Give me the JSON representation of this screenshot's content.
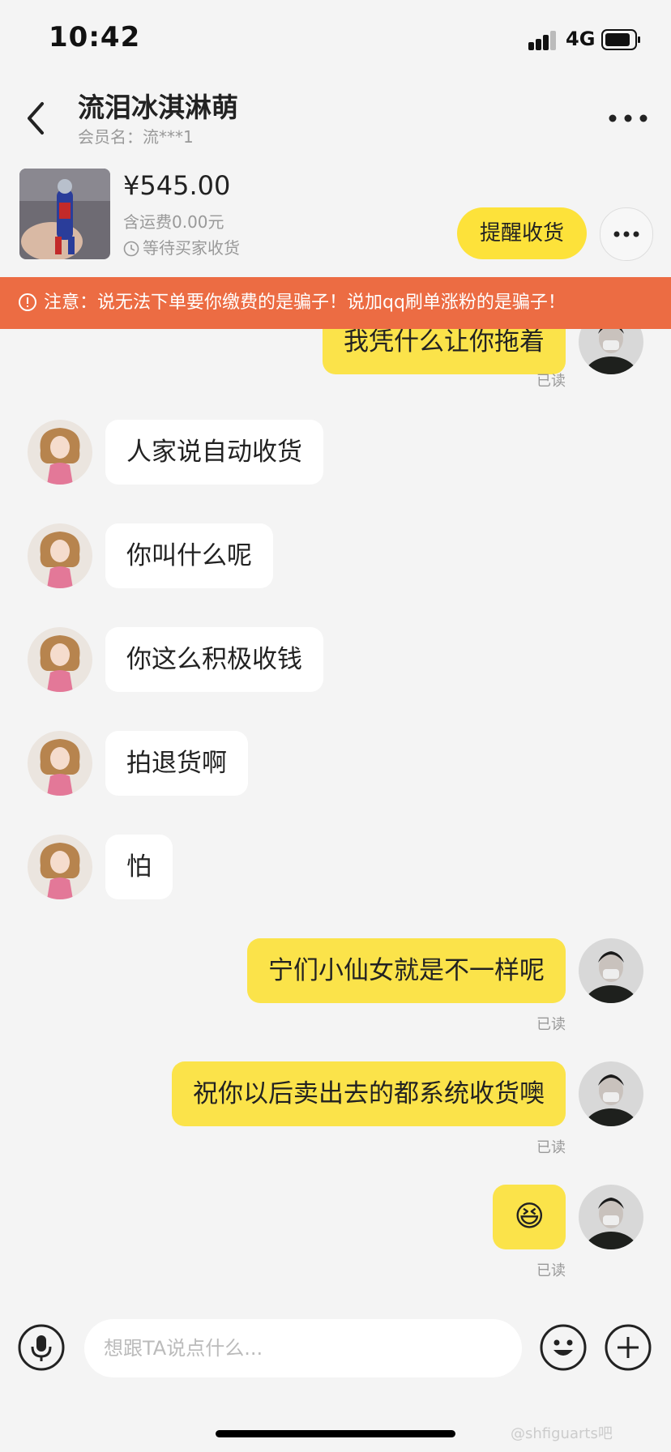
{
  "status_bar": {
    "time": "10:42",
    "network": "4G"
  },
  "header": {
    "title": "流泪冰淇淋萌",
    "subtitle": "会员名：流***1"
  },
  "order": {
    "price": "¥545.00",
    "shipping": "含运费0.00元",
    "status": "等待买家收货",
    "remind_button": "提醒收货"
  },
  "warning": {
    "text": "注意：说无法下单要你缴费的是骗子！说加qq刷单涨粉的是骗子！"
  },
  "messages": {
    "m0": {
      "text": "我凭什么让你拖着",
      "read": "已读"
    },
    "m1": {
      "text": "人家说自动收货"
    },
    "m2": {
      "text": "你叫什么呢"
    },
    "m3": {
      "text": "你这么积极收钱"
    },
    "m4": {
      "text": "拍退货啊"
    },
    "m5": {
      "text": "怕"
    },
    "m6": {
      "text": "宁们小仙女就是不一样呢",
      "read": "已读"
    },
    "m7": {
      "text": "祝你以后卖出去的都系统收货噢",
      "read": "已读"
    },
    "m8": {
      "emoji": "😆",
      "read": "已读"
    }
  },
  "input": {
    "placeholder": "想跟TA说点什么..."
  },
  "watermark": "@shfiguarts吧",
  "icons": [
    "back-icon",
    "more-icon",
    "clock-icon",
    "warning-icon",
    "mic-icon",
    "emoji-icon",
    "plus-icon",
    "signal-icon",
    "battery-icon"
  ],
  "colors": {
    "accent_yellow": "#fde23a",
    "warning_orange": "#ec6c43",
    "background": "#f4f4f4"
  }
}
